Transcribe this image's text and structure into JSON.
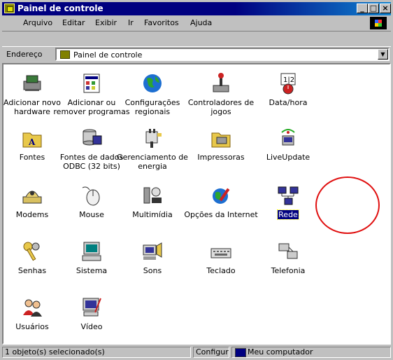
{
  "window": {
    "title": "Painel de controle"
  },
  "menu": [
    "Arquivo",
    "Editar",
    "Exibir",
    "Ir",
    "Favoritos",
    "Ajuda"
  ],
  "address": {
    "label": "Endereço",
    "value": "Painel de controle"
  },
  "items": [
    {
      "label1": "Adicionar novo",
      "label2": "hardware",
      "icon": "hardware-icon"
    },
    {
      "label1": "Adicionar ou",
      "label2": "remover programas",
      "icon": "programs-icon"
    },
    {
      "label1": "Configurações",
      "label2": "regionais",
      "icon": "globe-icon"
    },
    {
      "label1": "Controladores de",
      "label2": "jogos",
      "icon": "joystick-icon"
    },
    {
      "label1": "Data/hora",
      "label2": "",
      "icon": "clock-icon"
    },
    {
      "label1": "Fontes",
      "label2": "",
      "icon": "fonts-folder-icon"
    },
    {
      "label1": "Fontes de dados",
      "label2": "ODBC (32 bits)",
      "icon": "odbc-icon"
    },
    {
      "label1": "Gerenciamento de",
      "label2": "energia",
      "icon": "power-icon"
    },
    {
      "label1": "Impressoras",
      "label2": "",
      "icon": "printers-folder-icon"
    },
    {
      "label1": "LiveUpdate",
      "label2": "",
      "icon": "liveupdate-icon"
    },
    {
      "label1": "Modems",
      "label2": "",
      "icon": "modem-icon"
    },
    {
      "label1": "Mouse",
      "label2": "",
      "icon": "mouse-icon"
    },
    {
      "label1": "Multimídia",
      "label2": "",
      "icon": "multimedia-icon"
    },
    {
      "label1": "Opções da Internet",
      "label2": "",
      "icon": "internet-icon"
    },
    {
      "label1": "Rede",
      "label2": "",
      "icon": "network-icon"
    },
    {
      "label1": "Senhas",
      "label2": "",
      "icon": "keys-icon"
    },
    {
      "label1": "Sistema",
      "label2": "",
      "icon": "computer-icon"
    },
    {
      "label1": "Sons",
      "label2": "",
      "icon": "speaker-icon"
    },
    {
      "label1": "Teclado",
      "label2": "",
      "icon": "keyboard-icon"
    },
    {
      "label1": "Telefonia",
      "label2": "",
      "icon": "telephony-icon"
    },
    {
      "label1": "Usuários",
      "label2": "",
      "icon": "users-icon"
    },
    {
      "label1": "Vídeo",
      "label2": "",
      "icon": "video-icon"
    }
  ],
  "status": {
    "selected": "1 objeto(s) selecionado(s)",
    "middle": "Configura",
    "location": "Meu computador"
  }
}
